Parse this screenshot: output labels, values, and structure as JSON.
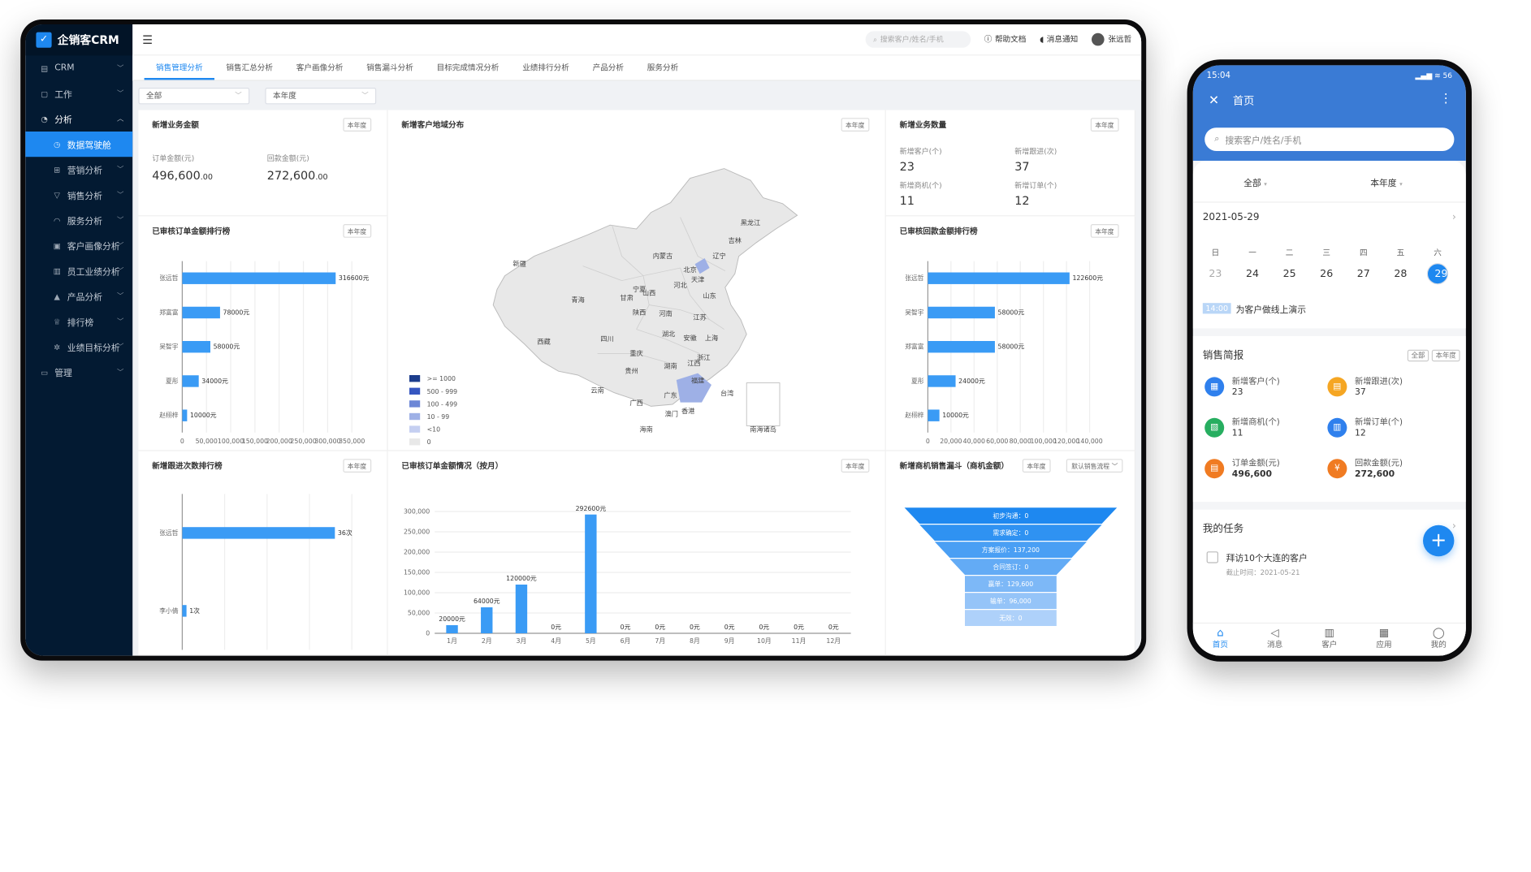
{
  "app": {
    "name": "企销客CRM"
  },
  "sidebar": {
    "items": [
      {
        "icon": "crm-icon",
        "glyph": "▤",
        "label": "CRM",
        "level": 0
      },
      {
        "icon": "work-icon",
        "glyph": "▢",
        "label": "工作",
        "level": 0
      },
      {
        "icon": "analysis-icon",
        "glyph": "◔",
        "label": "分析",
        "level": 0,
        "expanded": true
      },
      {
        "icon": "dashboard-icon",
        "glyph": "◷",
        "label": "数据驾驶舱",
        "level": 1,
        "selected": true
      },
      {
        "icon": "marketing-icon",
        "glyph": "⊞",
        "label": "营销分析",
        "level": 1
      },
      {
        "icon": "funnel-icon",
        "glyph": "▽",
        "label": "销售分析",
        "level": 1
      },
      {
        "icon": "headset-icon",
        "glyph": "◠",
        "label": "服务分析",
        "level": 1
      },
      {
        "icon": "portrait-icon",
        "glyph": "▣",
        "label": "客户画像分析",
        "level": 1
      },
      {
        "icon": "performance-icon",
        "glyph": "▥",
        "label": "员工业绩分析",
        "level": 1
      },
      {
        "icon": "product-icon",
        "glyph": "▲",
        "label": "产品分析",
        "level": 1
      },
      {
        "icon": "trophy-icon",
        "glyph": "♕",
        "label": "排行榜",
        "level": 1
      },
      {
        "icon": "target-icon",
        "glyph": "✲",
        "label": "业绩目标分析",
        "level": 1
      },
      {
        "icon": "manage-icon",
        "glyph": "▭",
        "label": "管理",
        "level": 0
      }
    ]
  },
  "topbar": {
    "search_placeholder": "搜索客户/姓名/手机",
    "help": "帮助文档",
    "notify": "消息通知",
    "user": "张远哲"
  },
  "tabs": [
    "销售管理分析",
    "销售汇总分析",
    "客户画像分析",
    "销售漏斗分析",
    "目标完成情况分析",
    "业绩排行分析",
    "产品分析",
    "服务分析"
  ],
  "filters": {
    "scope": "全部",
    "period": "本年度"
  },
  "badge_year": "本年度",
  "cards": {
    "amount": {
      "title": "新增业务金额",
      "order_label": "订单金额(元)",
      "order_value": "496,600",
      "order_cents": ".00",
      "refund_label": "回款金额(元)",
      "refund_value": "272,600",
      "refund_cents": ".00"
    },
    "region": {
      "title": "新增客户地域分布"
    },
    "count": {
      "title": "新增业务数量",
      "items": [
        {
          "label": "新增客户(个)",
          "value": "23"
        },
        {
          "label": "新增跟进(次)",
          "value": "37"
        },
        {
          "label": "新增商机(个)",
          "value": "11"
        },
        {
          "label": "新增订单(个)",
          "value": "12"
        }
      ]
    },
    "order_rank": {
      "title": "已审核订单金额排行榜"
    },
    "refund_rank": {
      "title": "已审核回款金额排行榜"
    },
    "followup_rank": {
      "title": "新增跟进次数排行榜"
    },
    "monthly": {
      "title": "已审核订单金额情况（按月）"
    },
    "funnel": {
      "title": "新增商机销售漏斗（商机金额）",
      "process": "默认销售流程"
    }
  },
  "map": {
    "provinces": [
      "黑龙江",
      "吉林",
      "辽宁",
      "内蒙古",
      "北京",
      "天津",
      "新疆",
      "宁夏",
      "河北",
      "山东",
      "青海",
      "甘肃",
      "山西",
      "陕西",
      "河南",
      "江苏",
      "西藏",
      "四川",
      "湖北",
      "安徽",
      "上海",
      "重庆",
      "浙江",
      "湖南",
      "江西",
      "贵州",
      "福建",
      "云南",
      "广西",
      "广东",
      "台湾",
      "香港",
      "澳门",
      "海南",
      "南海诸岛"
    ],
    "legend": [
      {
        "label": ">= 1000",
        "color": "#1c3d8c"
      },
      {
        "label": "500 - 999",
        "color": "#3556c0"
      },
      {
        "label": "100 - 499",
        "color": "#6c86d6"
      },
      {
        "label": "10 - 99",
        "color": "#9eb0e6"
      },
      {
        "label": "<10",
        "color": "#c5cff1"
      },
      {
        "label": "0",
        "color": "#e8e8e8"
      }
    ]
  },
  "chart_data": [
    {
      "type": "bar",
      "orientation": "horizontal",
      "title": "已审核订单金额排行榜",
      "categories": [
        "张远哲",
        "郑富富",
        "吴智宇",
        "夏彤",
        "赵栩梓"
      ],
      "values": [
        316600,
        78000,
        58000,
        34000,
        10000
      ],
      "value_labels": [
        "316600元",
        "78000元",
        "58000元",
        "34000元",
        "10000元"
      ],
      "xlim": [
        0,
        350000
      ],
      "x_ticks": [
        "0",
        "50,000",
        "100,000",
        "150,000",
        "200,000",
        "250,000",
        "300,000",
        "350,000"
      ]
    },
    {
      "type": "bar",
      "orientation": "horizontal",
      "title": "已审核回款金额排行榜",
      "categories": [
        "张远哲",
        "吴智宇",
        "郑富富",
        "夏彤",
        "赵栩梓"
      ],
      "values": [
        122600,
        58000,
        58000,
        24000,
        10000
      ],
      "value_labels": [
        "122600元",
        "58000元",
        "58000元",
        "24000元",
        "10000元"
      ],
      "xlim": [
        0,
        140000
      ],
      "x_ticks": [
        "0",
        "20,000",
        "40,000",
        "60,000",
        "80,000",
        "100,000",
        "120,000",
        "140,000"
      ]
    },
    {
      "type": "bar",
      "orientation": "horizontal",
      "title": "新增跟进次数排行榜",
      "categories": [
        "张远哲",
        "李小倩"
      ],
      "values": [
        36,
        1
      ],
      "value_labels": [
        "36次",
        "1次"
      ],
      "xlim": [
        0,
        40
      ],
      "x_ticks": [
        "0",
        "10",
        "20",
        "30",
        "40"
      ]
    },
    {
      "type": "bar",
      "title": "已审核订单金额情况（按月）",
      "categories": [
        "1月",
        "2月",
        "3月",
        "4月",
        "5月",
        "6月",
        "7月",
        "8月",
        "9月",
        "10月",
        "11月",
        "12月"
      ],
      "values": [
        20000,
        64000,
        120000,
        0,
        292600,
        0,
        0,
        0,
        0,
        0,
        0,
        0
      ],
      "value_labels": [
        "20000元",
        "64000元",
        "120000元",
        "0元",
        "292600元",
        "0元",
        "0元",
        "0元",
        "0元",
        "0元",
        "0元",
        "0元"
      ],
      "ylim": [
        0,
        300000
      ],
      "y_ticks": [
        "0",
        "50,000",
        "100,000",
        "150,000",
        "200,000",
        "250,000",
        "300,000"
      ]
    },
    {
      "type": "funnel",
      "title": "新增商机销售漏斗（商机金额）",
      "stages": [
        "初步沟通：0",
        "需求确定：0",
        "方案报价：137,200",
        "合同签订：0",
        "赢单：129,600",
        "输单：96,000",
        "无效：0"
      ]
    }
  ],
  "colors": {
    "accent": "#1e88f0",
    "bar": "#3a9bf5",
    "sidebar": "#031a32"
  },
  "phone": {
    "time": "15:04",
    "status_right": "▂▄▆ ≋ 56",
    "title": "首页",
    "search_placeholder": "搜索客户/姓名/手机",
    "filter_scope": "全部",
    "filter_period": "本年度",
    "date": "2021-05-29",
    "weekdays": [
      "日",
      "一",
      "二",
      "三",
      "四",
      "五",
      "六"
    ],
    "days": [
      "23",
      "24",
      "25",
      "26",
      "27",
      "28",
      "29"
    ],
    "event_time": "14:00",
    "event_text": "为客户做线上演示",
    "report_title": "销售简报",
    "chip_all": "全部",
    "chip_year": "本年度",
    "kpis": [
      {
        "label": "新增客户(个)",
        "value": "23",
        "color": "#2f80ed",
        "glyph": "▦"
      },
      {
        "label": "新增跟进(次)",
        "value": "37",
        "color": "#f5a623",
        "glyph": "▤"
      },
      {
        "label": "新增商机(个)",
        "value": "11",
        "color": "#27ae60",
        "glyph": "▧"
      },
      {
        "label": "新增订单(个)",
        "value": "12",
        "color": "#2f80ed",
        "glyph": "▥"
      },
      {
        "label": "订单金额(元)",
        "value": "496,600",
        "color": "#f07b22",
        "glyph": "▤"
      },
      {
        "label": "回款金额(元)",
        "value": "272,600",
        "color": "#f07b22",
        "glyph": "¥"
      }
    ],
    "task_title": "我的任务",
    "task_text": "拜访10个大连的客户",
    "task_deadline": "截止时间：2021-05-21",
    "nav": [
      {
        "label": "首页",
        "glyph": "⌂",
        "active": true
      },
      {
        "label": "消息",
        "glyph": "◁"
      },
      {
        "label": "客户",
        "glyph": "▥"
      },
      {
        "label": "应用",
        "glyph": "▦"
      },
      {
        "label": "我的",
        "glyph": "◯"
      }
    ]
  }
}
